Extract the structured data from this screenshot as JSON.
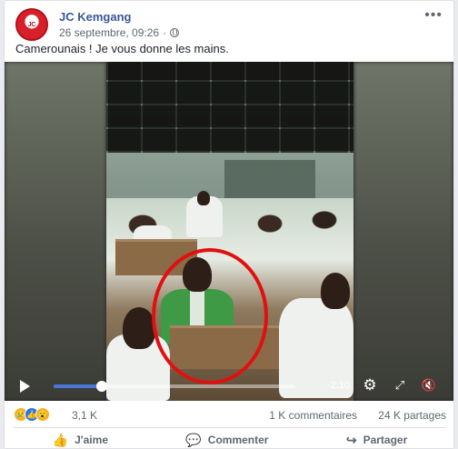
{
  "post": {
    "author": "JC Kemgang",
    "avatar_text": "JC",
    "timestamp": "26 septembre, 09:26",
    "text": "Camerounais ! Je vous donne les mains."
  },
  "video": {
    "time_remaining": "-2:10",
    "progress": 0.2
  },
  "stats": {
    "reaction_count": "3,1 K",
    "comments": "1 K commentaires",
    "shares": "24 K partages"
  },
  "actions": {
    "like": "J'aime",
    "comment": "Commenter",
    "share": "Partager"
  },
  "icons": {
    "like": "thumbs-up-icon",
    "comment": "speech-bubble-icon",
    "share": "share-arrow-icon",
    "settings": "gear-icon",
    "fullscreen": "expand-icon",
    "volume": "volume-muted-icon",
    "audience": "globe-icon"
  },
  "colors": {
    "author": "#385898",
    "progress": "#4a76d8",
    "circle": "#e01010"
  }
}
